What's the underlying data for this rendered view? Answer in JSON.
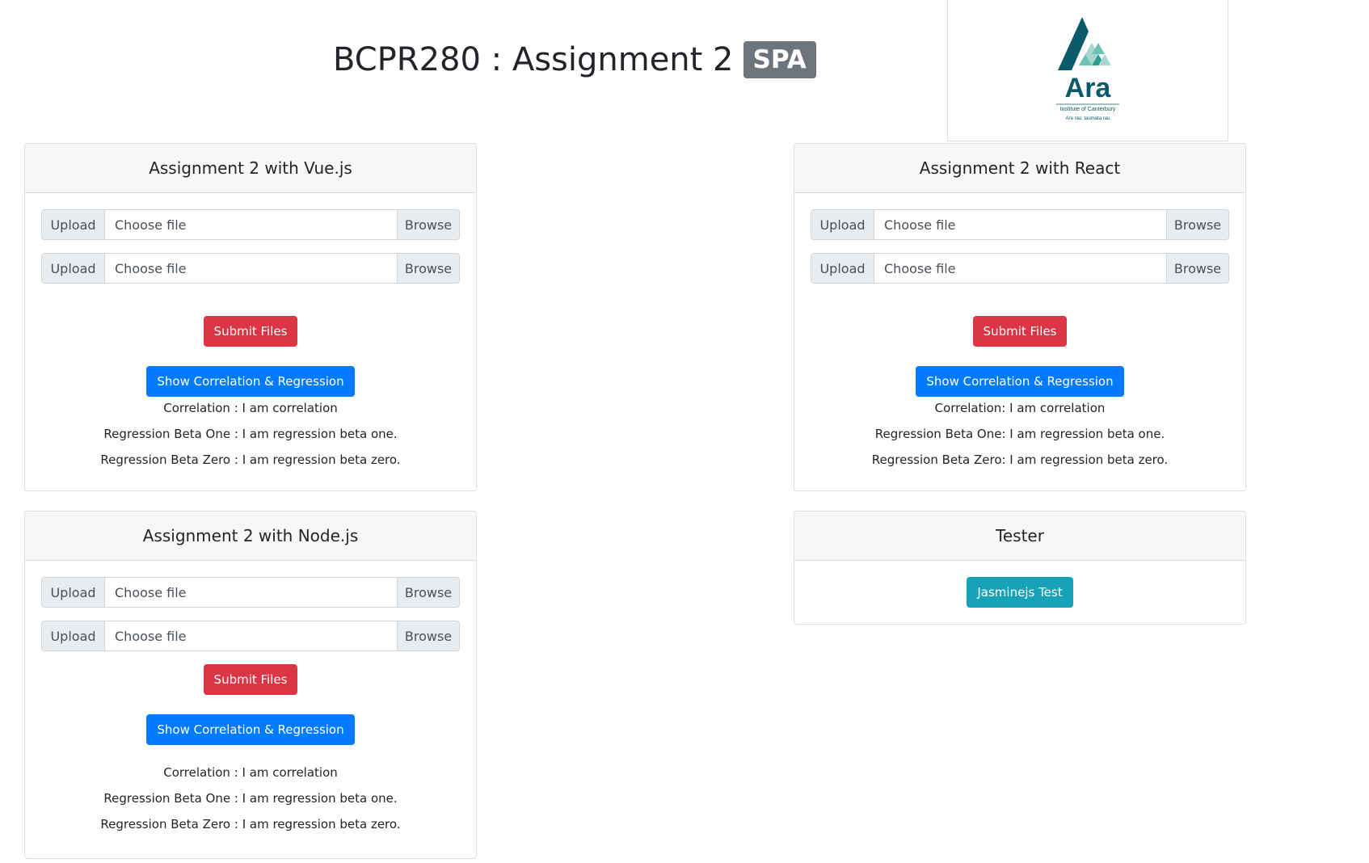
{
  "header": {
    "title": "BCPR280 : Assignment 2",
    "badge": "SPA",
    "logo_text": "Ara",
    "logo_subtitle": "Institute of Canterbury",
    "logo_tagline": "Ara rau, taumata rau",
    "brand_color": "#0b5a6b"
  },
  "cards": {
    "vue": {
      "title": "Assignment 2 with Vue.js",
      "files": [
        {
          "prepend": "Upload",
          "placeholder": "Choose file",
          "browse": "Browse"
        },
        {
          "prepend": "Upload",
          "placeholder": "Choose file",
          "browse": "Browse"
        }
      ],
      "submit_label": "Submit Files",
      "show_label": "Show Correlation & Regression",
      "results": [
        "Correlation : I am correlation",
        "Regression Beta One : I am regression beta one.",
        "Regression Beta Zero : I am regression beta zero."
      ]
    },
    "react": {
      "title": "Assignment 2 with React",
      "files": [
        {
          "prepend": "Upload",
          "placeholder": "Choose file",
          "browse": "Browse"
        },
        {
          "prepend": "Upload",
          "placeholder": "Choose file",
          "browse": "Browse"
        }
      ],
      "submit_label": "Submit Files",
      "show_label": "Show Correlation & Regression",
      "results": [
        "Correlation:  I am correlation",
        "Regression Beta One:  I am regression beta one.",
        "Regression Beta Zero:  I am regression beta zero."
      ]
    },
    "node": {
      "title": "Assignment 2 with Node.js",
      "files": [
        {
          "prepend": "Upload",
          "placeholder": "Choose file",
          "browse": "Browse"
        },
        {
          "prepend": "Upload",
          "placeholder": "Choose file",
          "browse": "Browse"
        }
      ],
      "submit_label": "Submit Files",
      "show_label": "Show Correlation & Regression",
      "results": [
        "Correlation : I am correlation",
        "Regression Beta One : I am regression beta one.",
        "Regression Beta Zero : I am regression beta zero."
      ]
    },
    "tester": {
      "title": "Tester",
      "test_label": "Jasminejs Test"
    }
  },
  "colors": {
    "danger": "#dc3545",
    "primary": "#007bff",
    "info": "#17a2b8",
    "badge": "#6c757d"
  }
}
